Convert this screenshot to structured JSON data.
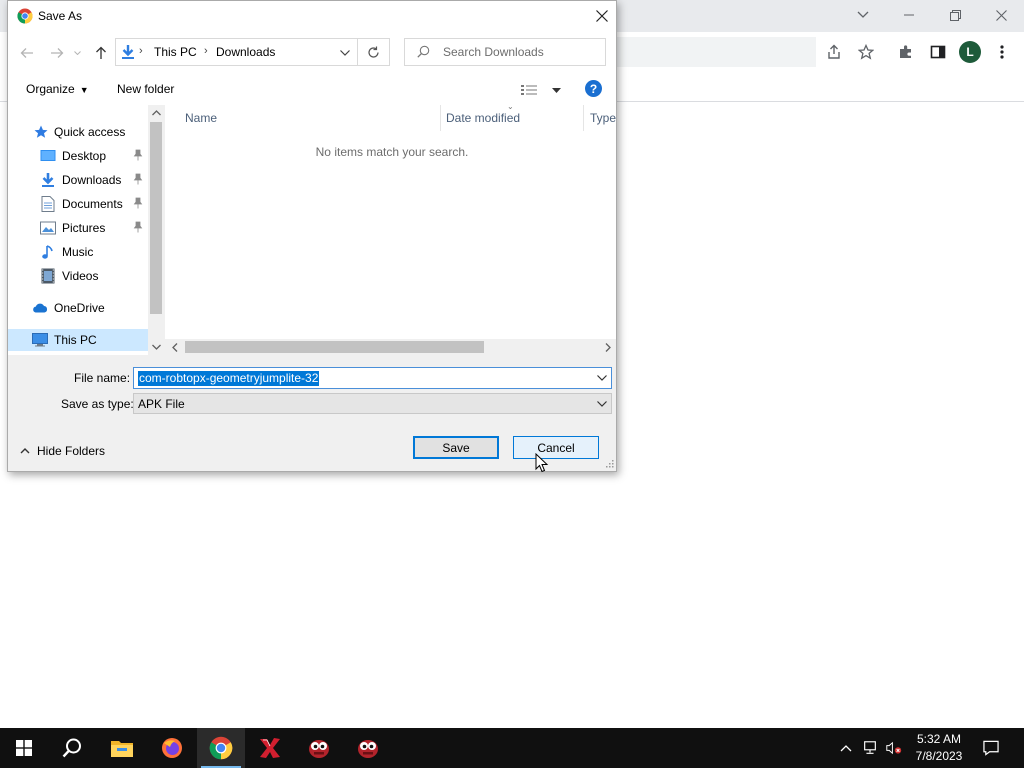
{
  "dialog": {
    "title": "Save As",
    "address": {
      "segments": [
        "This PC",
        "Downloads"
      ]
    },
    "search": {
      "placeholder": "Search Downloads"
    },
    "toolbar": {
      "organize": "Organize",
      "new_folder": "New folder"
    },
    "nav": {
      "items": [
        {
          "label": "Quick access",
          "icon": "star-icon"
        },
        {
          "label": "Desktop",
          "icon": "desktop-folder-icon",
          "pinned": true
        },
        {
          "label": "Downloads",
          "icon": "downloads-folder-icon",
          "pinned": true
        },
        {
          "label": "Documents",
          "icon": "documents-folder-icon",
          "pinned": true
        },
        {
          "label": "Pictures",
          "icon": "pictures-folder-icon",
          "pinned": true
        },
        {
          "label": "Music",
          "icon": "music-note-icon"
        },
        {
          "label": "Videos",
          "icon": "videos-folder-icon"
        },
        {
          "label": "OneDrive",
          "icon": "cloud-icon"
        },
        {
          "label": "This PC",
          "icon": "computer-icon",
          "selected": true
        }
      ]
    },
    "filelist": {
      "columns": [
        "Name",
        "Date modified",
        "Type"
      ],
      "empty_message": "No items match your search."
    },
    "form": {
      "file_name_label": "File name:",
      "file_name_value": "com-robtopx-geometryjumplite-32",
      "save_type_label": "Save as type:",
      "save_type_value": "APK File"
    },
    "footer": {
      "hide_folders": "Hide Folders",
      "save": "Save",
      "cancel": "Cancel"
    }
  },
  "browser": {
    "profile_initial": "L"
  },
  "taskbar": {
    "apps": [
      "start-icon",
      "search-icon",
      "file-explorer-icon",
      "firefox-icon",
      "chrome-icon",
      "app-x-icon",
      "game-icon",
      "game-icon-2"
    ],
    "time": "5:32 AM",
    "date": "7/8/2023"
  },
  "colors": {
    "accent": "#0078d7",
    "taskbar": "#101010",
    "selection": "#cce8ff"
  }
}
